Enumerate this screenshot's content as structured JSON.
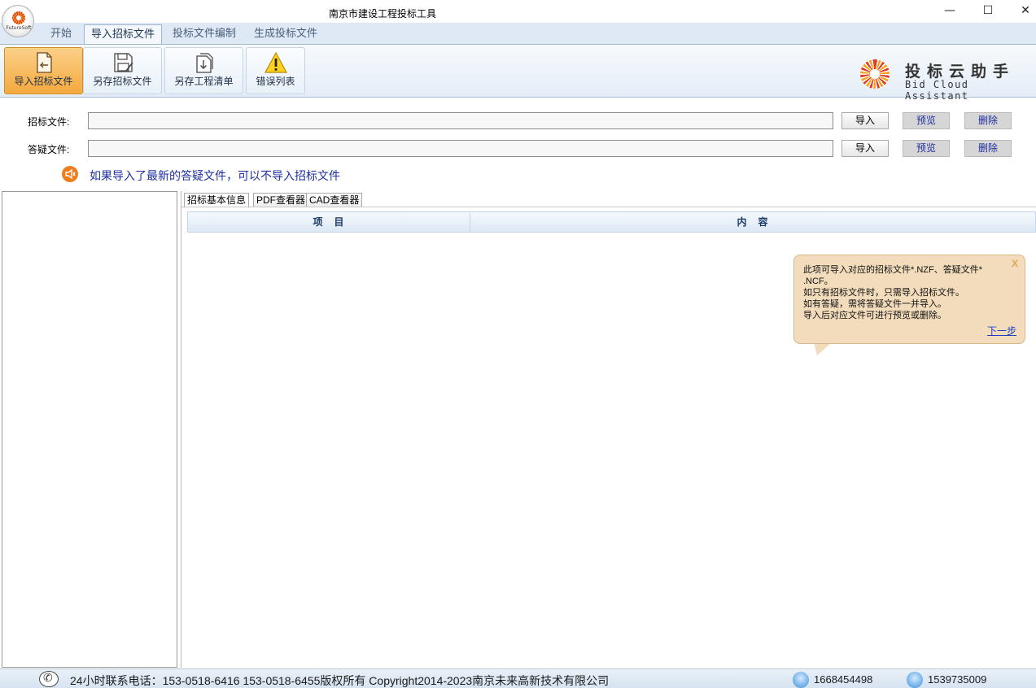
{
  "window": {
    "title": "南京市建设工程投标工具",
    "logo_text": "FutureSoft",
    "minimize": "—",
    "maximize": "☐",
    "close": "✕"
  },
  "tabs": [
    {
      "label": "开始",
      "active": false
    },
    {
      "label": "导入招标文件",
      "active": true
    },
    {
      "label": "投标文件编制",
      "active": false
    },
    {
      "label": "生成投标文件",
      "active": false
    }
  ],
  "ribbon": {
    "buttons": [
      {
        "label": "导入招标文件",
        "icon": "import-file-icon",
        "active": true
      },
      {
        "label": "另存招标文件",
        "icon": "save-as-icon",
        "active": false
      },
      {
        "label": "另存工程清单",
        "icon": "export-list-icon",
        "active": false
      },
      {
        "label": "错误列表",
        "icon": "warning-icon",
        "active": false
      }
    ],
    "brand_cn": "投标云助手",
    "brand_en": "Bid Cloud Assistant"
  },
  "files": {
    "tender": {
      "label": "招标文件:",
      "value": "",
      "import": "导入",
      "preview": "预览",
      "delete": "删除"
    },
    "qa": {
      "label": "答疑文件:",
      "value": "",
      "import": "导入",
      "preview": "预览",
      "delete": "删除"
    }
  },
  "hint": "如果导入了最新的答疑文件，可以不导入招标文件",
  "subtabs": [
    "招标基本信息",
    "PDF查看器",
    "CAD查看器"
  ],
  "grid": {
    "col_item": "项　目",
    "col_content": "内　容"
  },
  "balloon": {
    "lines": [
      "此项可导入对应的招标文件*.NZF、答疑文件*",
      ".NCF。",
      "如只有招标文件时，只需导入招标文件。",
      "如有答疑，需将答疑文件一并导入。",
      "导入后对应文件可进行预览或删除。"
    ],
    "close": "X",
    "next": "下一步"
  },
  "status": {
    "contact": "24小时联系电话：153-0518-6416 153-0518-6455版权所有 Copyright2014-2023南京未来高新技术有限公司",
    "qq1": "1668454498",
    "qq2": "1539735009"
  },
  "colors": {
    "accent": "#f4a93e",
    "link": "#1d2fa0",
    "balloon": "#f2dcbc"
  }
}
